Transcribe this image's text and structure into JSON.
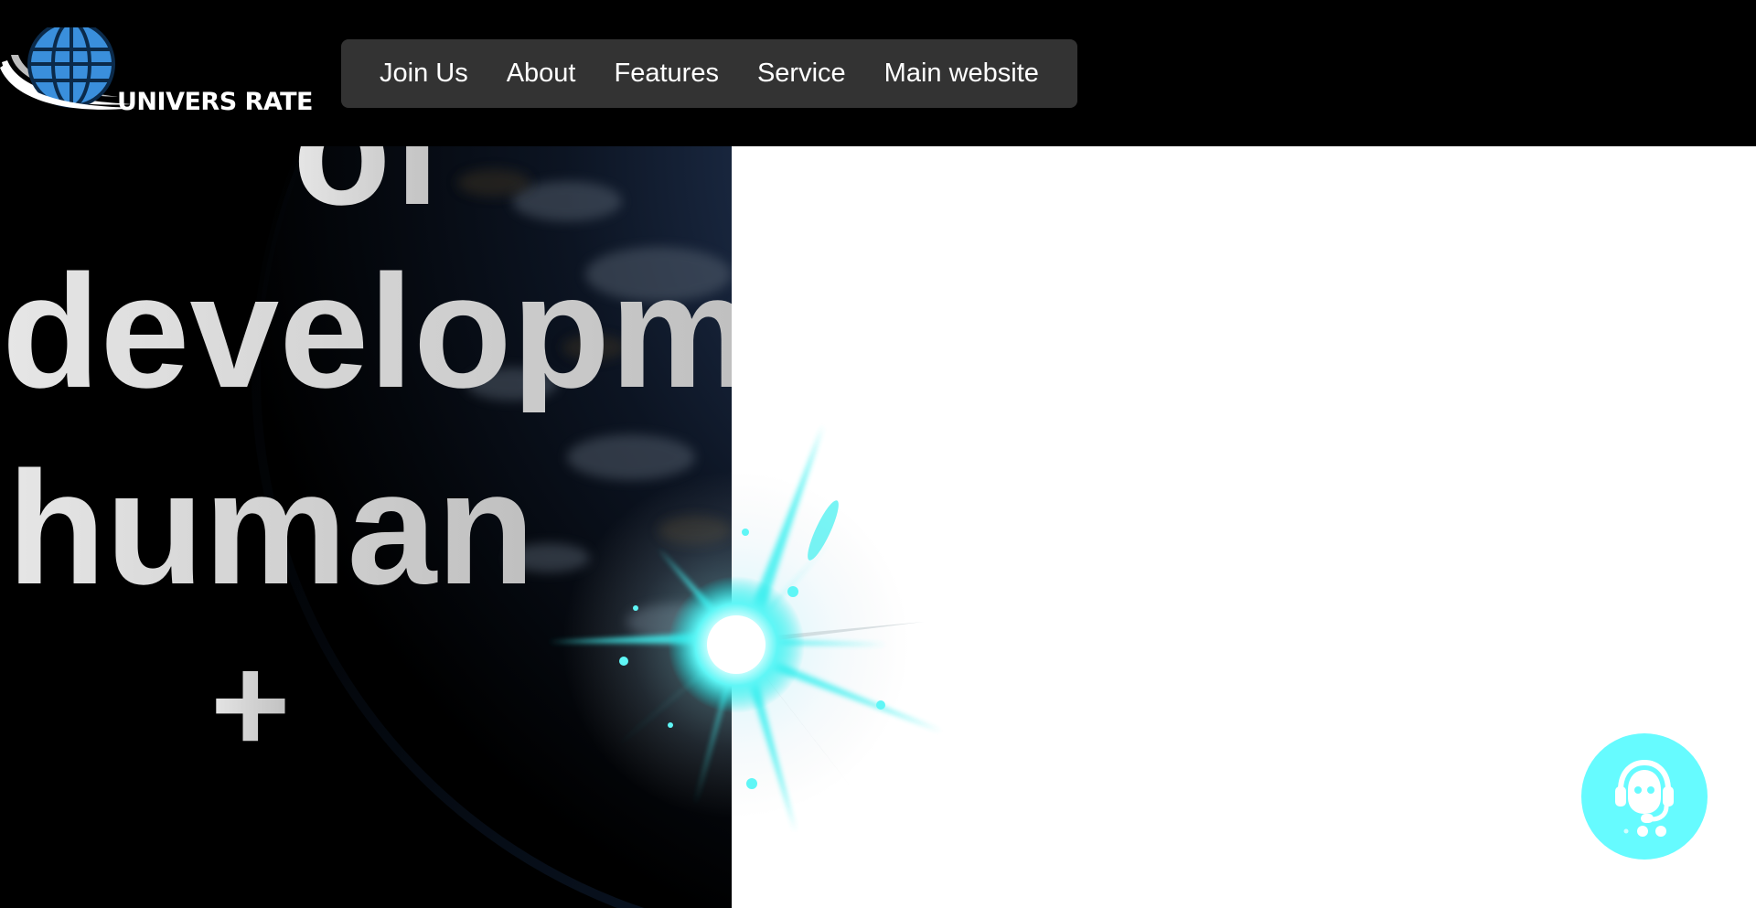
{
  "brand": {
    "name": "UNIVERS RATE",
    "logo_icon": "globe-swoosh-icon"
  },
  "nav": {
    "items": [
      {
        "label": "Join Us"
      },
      {
        "label": "About"
      },
      {
        "label": "Features"
      },
      {
        "label": "Service"
      },
      {
        "label": "Main website"
      }
    ]
  },
  "hero": {
    "lines": [
      "of",
      "developm",
      "human",
      "+"
    ]
  },
  "support": {
    "icon": "headset-support-icon"
  },
  "colors": {
    "header_bg": "#000000",
    "nav_bg": "#333333",
    "accent_cyan": "#66fbff",
    "logo_blue": "#3a8fdc",
    "hero_text": "#cfcfcf"
  }
}
